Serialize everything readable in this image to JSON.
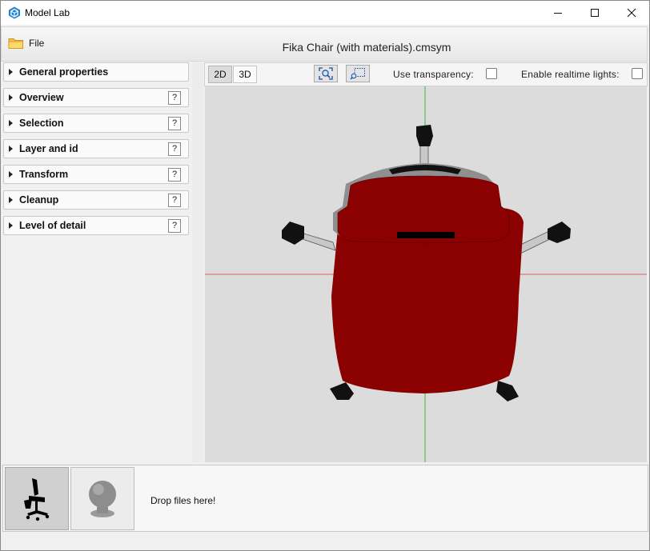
{
  "window": {
    "title": "Model Lab",
    "app_icon": "model-lab-icon"
  },
  "toolbar": {
    "file_label": "File",
    "document_title": "Fika Chair (with materials).cmsym"
  },
  "panels": [
    {
      "label": "General properties",
      "help": ""
    },
    {
      "label": "Overview",
      "help": "?"
    },
    {
      "label": "Selection",
      "help": "?"
    },
    {
      "label": "Layer and id",
      "help": "?"
    },
    {
      "label": "Transform",
      "help": "?"
    },
    {
      "label": "Cleanup",
      "help": "?"
    },
    {
      "label": "Level of detail",
      "help": "?"
    }
  ],
  "viewport_toolbar": {
    "mode_2d": "2D",
    "mode_3d": "3D",
    "active_mode": "2D",
    "transparency_label": "Use transparency:",
    "transparency_checked": false,
    "lights_label": "Enable realtime lights:",
    "lights_checked": false
  },
  "viewport": {
    "background": "#dcdcdc",
    "x_axis_color": "#e06060",
    "y_axis_color": "#3cb43c",
    "model_color": "#8b0000"
  },
  "bottom": {
    "drop_text": "Drop files here!"
  }
}
